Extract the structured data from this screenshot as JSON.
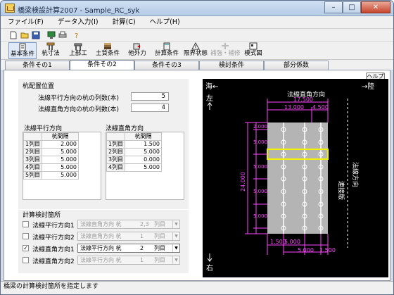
{
  "window": {
    "title": "橋梁検設計算2007 - Sample_RC_syk",
    "controls": {
      "min": "–",
      "max": "□",
      "close": "✕"
    }
  },
  "menu": [
    "ファイル(F)",
    "データ入力(I)",
    "計算(C)",
    "ヘルプ(H)"
  ],
  "toolbar": {
    "icons": [
      "new-file-icon",
      "open-folder-icon",
      "save-icon",
      "monitor-icon",
      "print-icon",
      "help-icon"
    ]
  },
  "toolbar2": {
    "buttons": [
      "基本条件",
      "杭寸法",
      "上部工",
      "土質条件",
      "他外力",
      "計算条件",
      "限界状態",
      "補強・補修",
      "模式図"
    ]
  },
  "tabs": [
    "条件その1",
    "条件その2",
    "条件その3",
    "検討条件",
    "部分係数"
  ],
  "help_label": "ヘルプ",
  "pile_layout": {
    "title": "杭配置位置",
    "row1_label": "法線平行方向の杭の列数(本)",
    "row1_value": "5",
    "row2_label": "法線直角方向の杭の列数(本)",
    "row2_value": "4"
  },
  "parallel_table": {
    "title": "法線平行方向",
    "header": "杭間隔",
    "rows": [
      {
        "name": "1列目",
        "value": "2.000"
      },
      {
        "name": "2列目",
        "value": "5.000"
      },
      {
        "name": "3列目",
        "value": "5.000"
      },
      {
        "name": "4列目",
        "value": "5.000"
      },
      {
        "name": "5列目",
        "value": "5.000"
      }
    ]
  },
  "perp_table": {
    "title": "法線直角方向",
    "header": "杭間隔",
    "rows": [
      {
        "name": "1列目",
        "value": "1.500"
      },
      {
        "name": "2列目",
        "value": "5.000"
      },
      {
        "name": "3列目",
        "value": "0.000"
      },
      {
        "name": "4列目",
        "value": "5.000"
      }
    ]
  },
  "calc": {
    "title": "計算検討箇所",
    "rows": [
      {
        "label": "法線平行方向1",
        "checked": false,
        "c1": "法線直角方向 杭",
        "c2": "2,3",
        "c3": "列目",
        "active": false
      },
      {
        "label": "法線平行方向2",
        "checked": false,
        "c1": "法線直角方向 杭",
        "c2": "1",
        "c3": "列目",
        "active": false
      },
      {
        "label": "法線直角方向1",
        "checked": true,
        "c1": "法線平行方向 杭",
        "c2": "2",
        "c3": "列目",
        "active": true
      },
      {
        "label": "法線直角方向2",
        "checked": false,
        "c1": "法線平行方向 杭",
        "c2": "1",
        "c3": "列目",
        "active": false
      }
    ]
  },
  "diagram": {
    "sea_label": "海←",
    "land_label": "→陸",
    "left_label": "左",
    "right_label": "右",
    "perp_label": "法線直角方向",
    "total_width": "17.500",
    "dim_left": "13.000",
    "dim_right": "4.500",
    "height": "24.000",
    "row_dims": [
      "2.000",
      "5.000",
      "5.000",
      "5.000",
      "5.000"
    ],
    "bottom_dims": [
      "1.500",
      "5.000",
      "5.000",
      "1.500"
    ],
    "slab_label": "連接版",
    "parallel_label": "法線方向",
    "colors": {
      "deck": "#b4b4b4",
      "dim": "#ff44ff",
      "highlight": "#f2f200",
      "bg": "#000000"
    }
  },
  "status": "橋梁の計算検討箇所を指定します"
}
